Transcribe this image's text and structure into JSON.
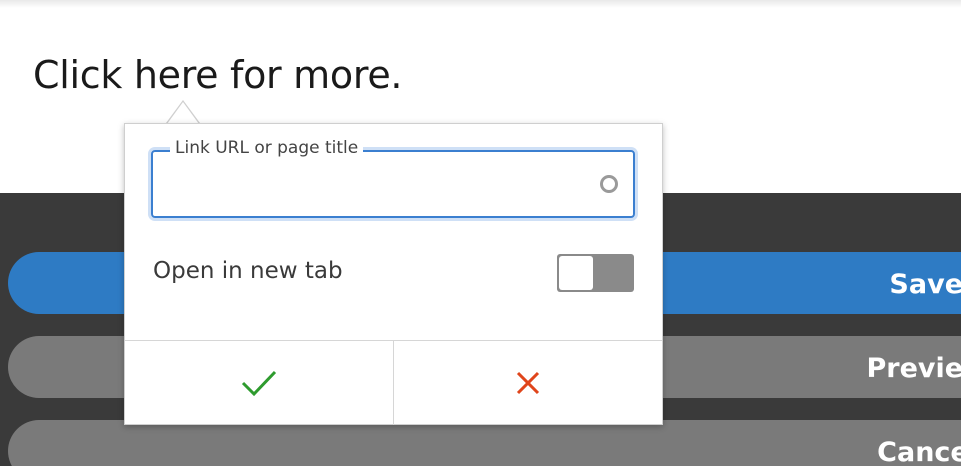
{
  "editor": {
    "text": "Click here for more."
  },
  "link_popup": {
    "url_label": "Link URL or page title",
    "url_value": "",
    "new_tab_label": "Open in new tab",
    "new_tab_enabled": false,
    "confirm_icon": "checkmark-icon",
    "dismiss_icon": "close-icon",
    "confirm_color": "#2e9b2e",
    "dismiss_color": "#e0451b"
  },
  "actions": {
    "save_label": "Save",
    "preview_label": "Preview",
    "cancel_label": "Cancel"
  },
  "colors": {
    "primary": "#2e7bc4",
    "secondary": "#7a7a7a",
    "panel": "#3a3a3a"
  }
}
